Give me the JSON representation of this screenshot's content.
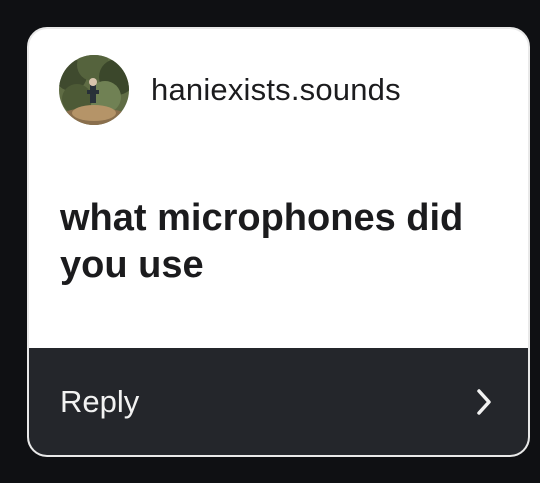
{
  "header": {
    "username": "haniexists.sounds"
  },
  "question": {
    "text": "what microphones did you use"
  },
  "reply": {
    "label": "Reply"
  },
  "icons": {
    "avatar": "profile-photo",
    "chevron": "chevron-right-icon"
  },
  "colors": {
    "page_background": "#0f1013",
    "card_background": "#ffffff",
    "reply_bar": "#24262b"
  }
}
